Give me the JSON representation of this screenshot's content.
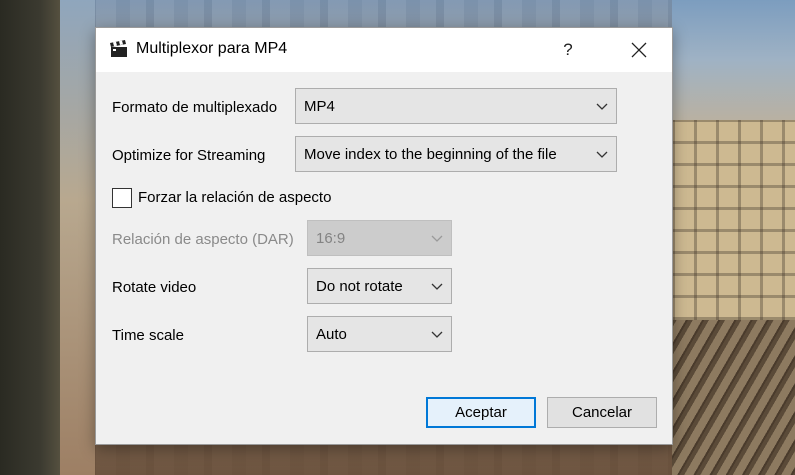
{
  "window": {
    "title": "Multiplexor para MP4",
    "help_label": "?",
    "app_icon": "clapperboard-icon",
    "close_icon": "close-icon"
  },
  "fields": {
    "format": {
      "label": "Formato de multiplexado",
      "value": "MP4"
    },
    "optimize": {
      "label": "Optimize for Streaming",
      "value": "Move index to the beginning of the file"
    },
    "force_aspect": {
      "label": "Forzar la relación de aspecto",
      "checked": false
    },
    "aspect": {
      "label": "Relación de aspecto (DAR)",
      "value": "16:9",
      "disabled": true
    },
    "rotate": {
      "label": "Rotate video",
      "value": "Do not rotate"
    },
    "time_scale": {
      "label": "Time scale",
      "value": "Auto"
    }
  },
  "buttons": {
    "accept": "Aceptar",
    "cancel": "Cancelar"
  },
  "colors": {
    "accent": "#0078d7",
    "dialog_bg": "#f0f0f0",
    "combo_bg": "#e5e5e5"
  }
}
